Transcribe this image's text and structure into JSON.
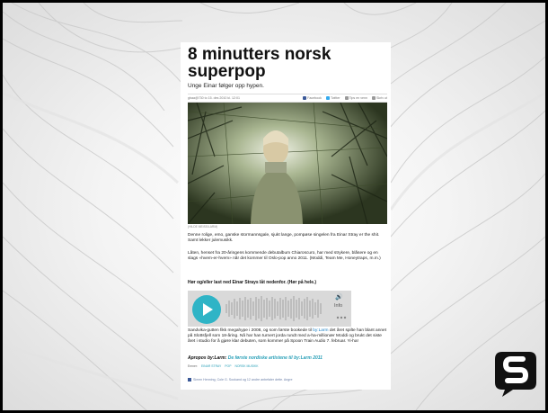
{
  "article": {
    "title": "8 minutters norsk superpop",
    "subtitle": "Unge Einar følger opp hypen.",
    "date": "gbaa@730 to 15. des 2010 kl. 12:01",
    "share": [
      "Facebook",
      "Twitter",
      "Tips en venn",
      "Skriv ut"
    ],
    "photo_caption": "(HILDE MEISS/LARM)",
    "paragraph1": "Denne rolige, emo, ganske stormannsgale, sjukt lange, pompøse singelen fra Einar Stray er the shit. Samt lekker julemusikk.",
    "paragraph2": "Låten, henset fra 20-åringens kommende debutalbum Chiaroscuro, har med strykere, blåsere og en slags «hvem-er-hvem» når det kommer til Oslo-pop anno 2011. (Moddi, Team Me, Honeytraps, m.m.)",
    "listen_prompt": "Hør og/eller last ned Einar Strays låt nedenfor. (Hør på hele.)",
    "player": {
      "info_label": "Info",
      "volume_icon": "speaker-icon",
      "play_icon": "play-icon"
    },
    "paragraph3_a": "Sandvika-gutten fikk megahype i 2008, og som første bookede til ",
    "paragraph3_link": "by:Larm",
    "paragraph3_b": " det året spilte han blant annet på Slottsfjell som 18-åring. Nå har han turnert jorda rundt med a-ha-millionær Moddi og brukt det siste året i studio for å gjøre klar debuten, som kommer på Spoon Train Audio 7. februar. Yi-ha!",
    "apropos_label": "Apropos by:Larm:",
    "apropos_link": "De første nordiske artistene til by:Larm 2011",
    "tags_label": "Emner:",
    "tags": [
      "EINAR STRAY",
      "POP",
      "NORSK MUSIKK"
    ],
    "facebook_line": "Simen Henning, Cole G. Sookand og 12 andre anbefaler dette.  Angre"
  },
  "colors": {
    "accent": "#2fb4c6",
    "logo": "#111111",
    "link": "#1a7fc4"
  },
  "logo_icon": "brand-logo-icon"
}
